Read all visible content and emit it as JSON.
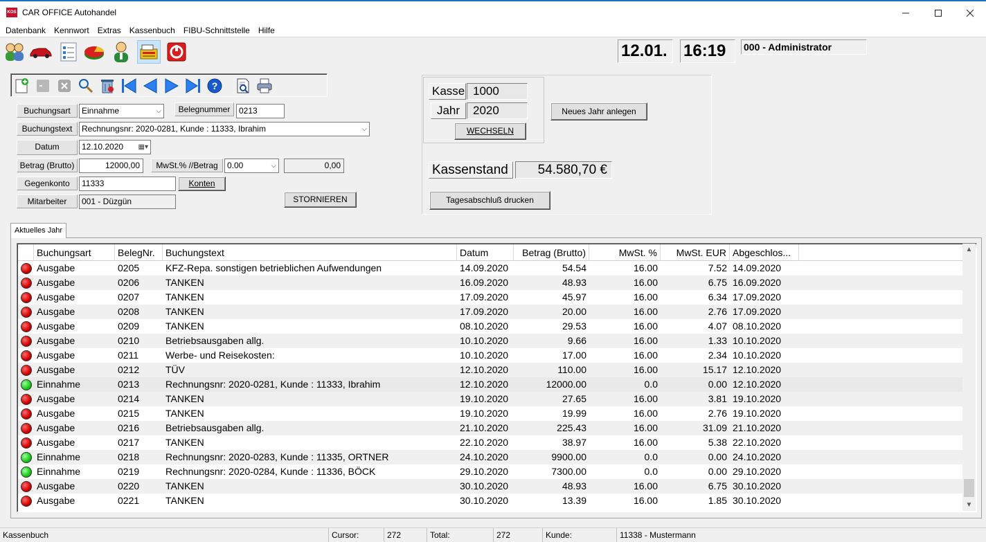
{
  "window": {
    "title": "CAR OFFICE Autohandel",
    "app_badge": "KOS"
  },
  "menu": [
    "Datenbank",
    "Kennwort",
    "Extras",
    "Kassenbuch",
    "FIBU-Schnittstelle",
    "Hilfe"
  ],
  "header": {
    "date": "12.01.",
    "time": "16:19",
    "user": "000 - Administrator"
  },
  "form": {
    "buchungsart_label": "Buchungsart",
    "buchungsart_value": "Einnahme",
    "belegnummer_label": "Belegnummer",
    "belegnummer_value": "0213",
    "buchungstext_label": "Buchungstext",
    "buchungstext_value": "Rechnungsnr: 2020-0281, Kunde : 11333, Ibrahim",
    "datum_label": "Datum",
    "datum_value": "12.10.2020",
    "betrag_label": "Betrag (Brutto)",
    "betrag_value": "12000,00",
    "mwst_label": "MwSt.% //Betrag",
    "mwst_value": "0.00",
    "mwst_betrag": "0,00",
    "gegenkonto_label": "Gegenkonto",
    "gegenkonto_value": "11333",
    "konten_button": "Konten",
    "mitarbeiter_label": "Mitarbeiter",
    "mitarbeiter_value": "001 - Düzgün",
    "stornieren_button": "STORNIEREN"
  },
  "kasse": {
    "kasse_label": "Kasse",
    "kasse_value": "1000",
    "jahr_label": "Jahr",
    "jahr_value": "2020",
    "wechseln_button": "WECHSELN",
    "neues_jahr_button": "Neues Jahr anlegen",
    "kassenstand_label": "Kassenstand",
    "kassenstand_value": "54.580,70 €",
    "tagesabschluss_button": "Tagesabschluß drucken"
  },
  "tab": {
    "label": "Aktuelles Jahr"
  },
  "grid": {
    "columns": [
      "Buchungsart",
      "BelegNr.",
      "Buchungstext",
      "Datum",
      "Betrag (Brutto)",
      "MwSt. %",
      "MwSt. EUR",
      "Abgeschlos..."
    ],
    "rows": [
      {
        "status": "red",
        "art": "Ausgabe",
        "nr": "0205",
        "text": "KFZ-Repa. sonstigen betrieblichen Aufwendungen",
        "datum": "14.09.2020",
        "betrag": "54.54",
        "mwst": "16.00",
        "mwst_eur": "7.52",
        "abg": "14.09.2020"
      },
      {
        "status": "red",
        "art": "Ausgabe",
        "nr": "0206",
        "text": "TANKEN",
        "datum": "16.09.2020",
        "betrag": "48.93",
        "mwst": "16.00",
        "mwst_eur": "6.75",
        "abg": "16.09.2020"
      },
      {
        "status": "red",
        "art": "Ausgabe",
        "nr": "0207",
        "text": "TANKEN",
        "datum": "17.09.2020",
        "betrag": "45.97",
        "mwst": "16.00",
        "mwst_eur": "6.34",
        "abg": "17.09.2020"
      },
      {
        "status": "red",
        "art": "Ausgabe",
        "nr": "0208",
        "text": "TANKEN",
        "datum": "17.09.2020",
        "betrag": "20.00",
        "mwst": "16.00",
        "mwst_eur": "2.76",
        "abg": "17.09.2020"
      },
      {
        "status": "red",
        "art": "Ausgabe",
        "nr": "0209",
        "text": "TANKEN",
        "datum": "08.10.2020",
        "betrag": "29.53",
        "mwst": "16.00",
        "mwst_eur": "4.07",
        "abg": "08.10.2020"
      },
      {
        "status": "red",
        "art": "Ausgabe",
        "nr": "0210",
        "text": "Betriebsausgaben allg.",
        "datum": "10.10.2020",
        "betrag": "9.66",
        "mwst": "16.00",
        "mwst_eur": "1.33",
        "abg": "10.10.2020"
      },
      {
        "status": "red",
        "art": "Ausgabe",
        "nr": "0211",
        "text": "Werbe- und Reisekosten:",
        "datum": "10.10.2020",
        "betrag": "17.00",
        "mwst": "16.00",
        "mwst_eur": "2.34",
        "abg": "10.10.2020"
      },
      {
        "status": "red",
        "art": "Ausgabe",
        "nr": "0212",
        "text": "TÜV",
        "datum": "12.10.2020",
        "betrag": "110.00",
        "mwst": "16.00",
        "mwst_eur": "15.17",
        "abg": "12.10.2020"
      },
      {
        "status": "green",
        "art": "Einnahme",
        "nr": "0213",
        "text": "Rechnungsnr: 2020-0281, Kunde : 11333, Ibrahim",
        "datum": "12.10.2020",
        "betrag": "12000.00",
        "mwst": "0.0",
        "mwst_eur": "0.00",
        "abg": "12.10.2020"
      },
      {
        "status": "red",
        "art": "Ausgabe",
        "nr": "0214",
        "text": "TANKEN",
        "datum": "19.10.2020",
        "betrag": "27.65",
        "mwst": "16.00",
        "mwst_eur": "3.81",
        "abg": "19.10.2020"
      },
      {
        "status": "red",
        "art": "Ausgabe",
        "nr": "0215",
        "text": "TANKEN",
        "datum": "19.10.2020",
        "betrag": "19.99",
        "mwst": "16.00",
        "mwst_eur": "2.76",
        "abg": "19.10.2020"
      },
      {
        "status": "red",
        "art": "Ausgabe",
        "nr": "0216",
        "text": "Betriebsausgaben allg.",
        "datum": "21.10.2020",
        "betrag": "225.43",
        "mwst": "16.00",
        "mwst_eur": "31.09",
        "abg": "21.10.2020"
      },
      {
        "status": "red",
        "art": "Ausgabe",
        "nr": "0217",
        "text": "TANKEN",
        "datum": "22.10.2020",
        "betrag": "38.97",
        "mwst": "16.00",
        "mwst_eur": "5.38",
        "abg": "22.10.2020"
      },
      {
        "status": "green",
        "art": "Einnahme",
        "nr": "0218",
        "text": "Rechnungsnr: 2020-0283, Kunde : 11335, ORTNER",
        "datum": "24.10.2020",
        "betrag": "9900.00",
        "mwst": "0.0",
        "mwst_eur": "0.00",
        "abg": "24.10.2020"
      },
      {
        "status": "green",
        "art": "Einnahme",
        "nr": "0219",
        "text": "Rechnungsnr: 2020-0284, Kunde : 11336, BÖCK",
        "datum": "29.10.2020",
        "betrag": "7300.00",
        "mwst": "0.0",
        "mwst_eur": "0.00",
        "abg": "29.10.2020"
      },
      {
        "status": "red",
        "art": "Ausgabe",
        "nr": "0220",
        "text": "TANKEN",
        "datum": "30.10.2020",
        "betrag": "48.93",
        "mwst": "16.00",
        "mwst_eur": "6.75",
        "abg": "30.10.2020"
      },
      {
        "status": "red",
        "art": "Ausgabe",
        "nr": "0221",
        "text": "TANKEN",
        "datum": "30.10.2020",
        "betrag": "13.39",
        "mwst": "16.00",
        "mwst_eur": "1.85",
        "abg": "30.10.2020"
      }
    ]
  },
  "statusbar": {
    "module": "Kassenbuch",
    "cursor_label": "Cursor:",
    "cursor_value": "272",
    "total_label": "Total:",
    "total_value": "272",
    "kunde_label": "Kunde:",
    "kunde_value": "11338 - Mustermann"
  },
  "colors": {
    "titlebar_accent": "#1a73c9",
    "status_red": "#d00000",
    "status_green": "#18c818"
  }
}
